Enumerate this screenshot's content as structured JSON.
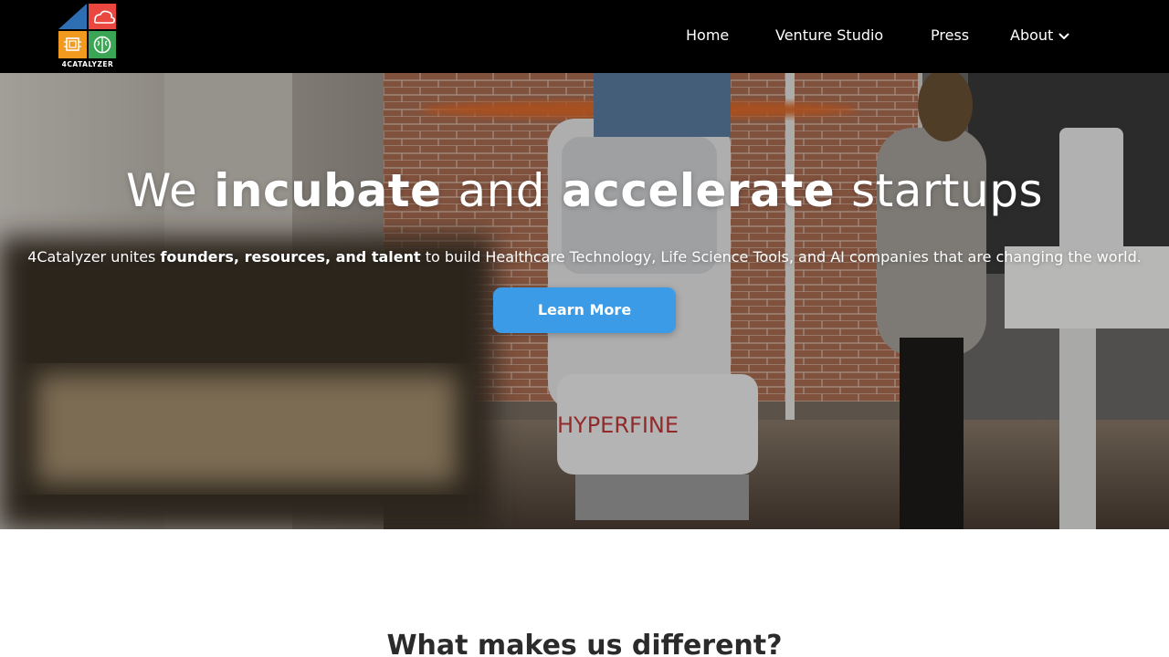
{
  "brand": {
    "logo_text": "4CATALYZER",
    "colors": {
      "blue": "#2e6fb3",
      "red": "#e9473f",
      "orange": "#f29a1f",
      "green": "#3aa655"
    }
  },
  "nav": {
    "items": [
      {
        "label": "Home"
      },
      {
        "label": "Venture Studio"
      },
      {
        "label": "Press"
      },
      {
        "label": "About",
        "icon": "chevron-down-icon"
      }
    ]
  },
  "hero": {
    "title": {
      "w1": "We",
      "w2": "incubate",
      "w3": "and",
      "w4": "accelerate",
      "w5": "startups"
    },
    "subtitle": {
      "pre": "4Catalyzer unites ",
      "bold": "founders, resources, and talent",
      "post": " to build Healthcare Technology, Life Science Tools, and AI companies that are changing the world."
    },
    "device_label": "HYPERFINE",
    "cta_label": "Learn More",
    "cta_color": "#3c9be6"
  },
  "section": {
    "title": "What makes us different?"
  }
}
